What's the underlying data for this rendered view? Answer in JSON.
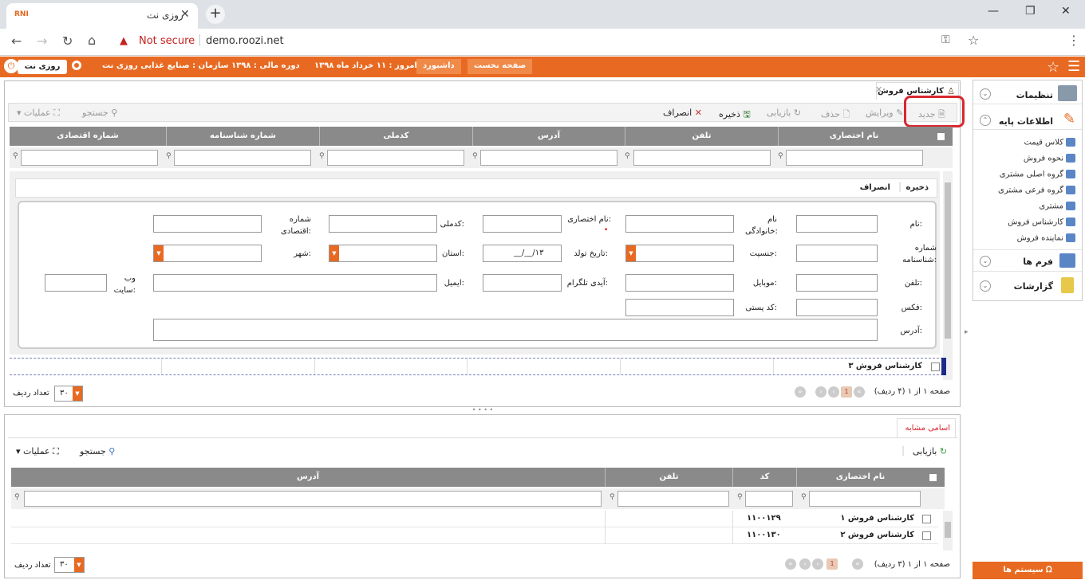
{
  "browser": {
    "tab_title": "روزی نت",
    "favicon_text": "RNI",
    "new_tab": "+",
    "minimize": "—",
    "maximize": "❐",
    "close": "✕",
    "security": "Not secure",
    "url": "demo.roozi.net"
  },
  "appbar": {
    "home_btn": "صفحه نخست",
    "dashboard_btn": "داشبورد",
    "today": "امروز : ۱۱ خرداد ماه ۱۳۹۸",
    "fiscal": "دوره مالی : ۱۳۹۸",
    "org": "سازمان : صنایع غذایی روزی نت",
    "brand": "روزی نت"
  },
  "sidebar": {
    "settings": "تنظیمات",
    "base_info": "اطلاعات پایه",
    "items": [
      "کلاس قیمت",
      "نحوه فروش",
      "گروه اصلی مشتری",
      "گروه فرعی مشتری",
      "مشتری",
      "کارشناس فروش",
      "نماینده فروش"
    ],
    "forms": "فرم ها",
    "reports": "گزارشات",
    "system": "سیستم ها"
  },
  "panel1": {
    "tab_title": "کارشناس فروش",
    "toolbar": {
      "new": "جدید",
      "edit": "ویرایش",
      "delete": "حذف",
      "restore": "بازیابی",
      "save": "ذخیره",
      "cancel": "انصراف",
      "search": "جستجو",
      "ops": "عملیات"
    },
    "columns": [
      "نام اختصاری",
      "تلفن",
      "آدرس",
      "کدملی",
      "شماره شناسنامه",
      "شماره اقتصادی"
    ],
    "form": {
      "save": "ذخیره",
      "cancel": "انصراف",
      "name": "نام:",
      "lastname": "نام خانوادگی:",
      "short_name": "نام اختصاری:",
      "required_mark": "•",
      "national_code": "کدملی:",
      "economic_no": "شماره اقتصادی:",
      "id_no": "شماره شناسنامه:",
      "gender": "جنسیت:",
      "birth_date": "تاریخ تولد:",
      "birth_value": "__/__/۱۳",
      "province": "استان:",
      "city": "شهر:",
      "phone": "تلفن:",
      "mobile": "موبایل:",
      "telegram": "آیدی تلگرام:",
      "email": "ایمیل:",
      "website": "وب سایت:",
      "fax": "فکس:",
      "postal": "کد پستی:",
      "address": "آدرس:"
    },
    "row": "کارشناس فروش ۳",
    "pager": "صفحه ۱ از ۱ (۴ ردیف)",
    "page_current": "1",
    "rows_per_page": "۳۰",
    "rows_label": "تعداد ردیف"
  },
  "panel2": {
    "tab_title": "اسامی مشابه",
    "toolbar": {
      "restore": "بازیابی",
      "search": "جستجو",
      "ops": "عملیات"
    },
    "columns": [
      "نام اختصاری",
      "کد",
      "تلفن",
      "آدرس"
    ],
    "rows": [
      {
        "name": "کارشناس فروش ۱",
        "code": "۱۱۰۰۱۲۹"
      },
      {
        "name": "کارشناس فروش ۲",
        "code": "۱۱۰۰۱۳۰"
      }
    ],
    "pager": "صفحه ۱ از ۱ (۳ ردیف)",
    "page_current": "1",
    "rows_per_page": "۳۰",
    "rows_label": "تعداد ردیف"
  }
}
